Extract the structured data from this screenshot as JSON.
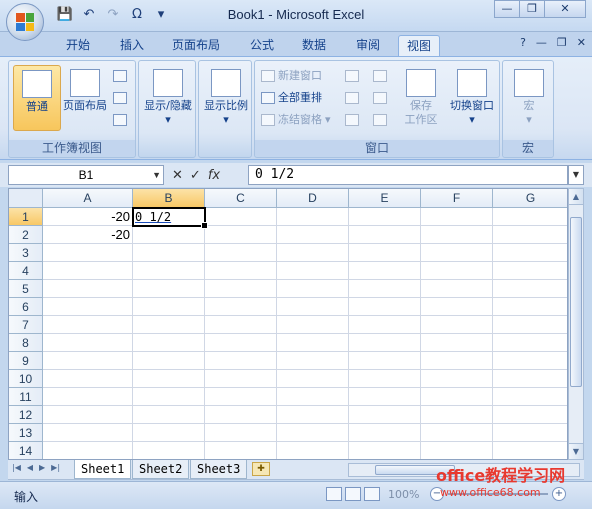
{
  "window": {
    "title": "Book1 - Microsoft Excel"
  },
  "quick_access": {
    "save": "💾",
    "undo": "↶",
    "redo": "↷",
    "omega": "Ω",
    "customize": "▾"
  },
  "window_controls": {
    "minimize": "—",
    "restore": "❐",
    "close": "✕"
  },
  "tabs": [
    {
      "label": "开始"
    },
    {
      "label": "插入"
    },
    {
      "label": "页面布局"
    },
    {
      "label": "公式"
    },
    {
      "label": "数据"
    },
    {
      "label": "审阅"
    },
    {
      "label": "视图"
    }
  ],
  "ribbon": {
    "workbook_views": {
      "label": "工作簿视图",
      "normal": "普通",
      "page_layout": "页面布局"
    },
    "show_hide": {
      "label": "显示/隐藏"
    },
    "zoom": {
      "label": "显示比例"
    },
    "window": {
      "label": "窗口",
      "new_window": "新建窗口",
      "arrange_all": "全部重排",
      "freeze_panes": "冻结窗格",
      "save_workspace": "保存",
      "save_workspace_2": "工作区",
      "switch_windows": "切换窗口"
    },
    "macros": {
      "label": "宏",
      "button": "宏"
    }
  },
  "formula_bar": {
    "name_box": "B1",
    "cancel": "✕",
    "enter": "✓",
    "fx": "fx",
    "content": "0 1/2"
  },
  "sheet": {
    "columns": [
      "A",
      "B",
      "C",
      "D",
      "E",
      "F",
      "G"
    ],
    "rows": [
      "1",
      "2",
      "3",
      "4",
      "5",
      "6",
      "7",
      "8",
      "9",
      "10",
      "11",
      "12",
      "13",
      "14"
    ],
    "cells": {
      "A1": "-20",
      "A2": "-20",
      "B1": "0 1/2"
    },
    "active_cell": "B1"
  },
  "sheet_tabs": [
    "Sheet1",
    "Sheet2",
    "Sheet3"
  ],
  "status": {
    "mode": "输入",
    "zoom": "100%"
  },
  "watermark": {
    "line1": "office教程学习网",
    "line2": "www.office68.com"
  }
}
